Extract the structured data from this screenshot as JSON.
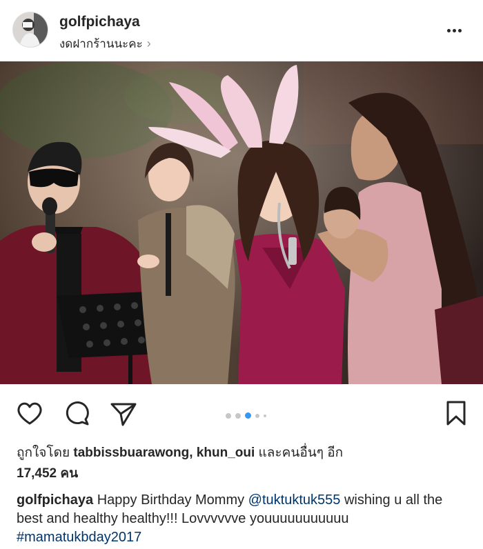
{
  "post": {
    "username": "golfpichaya",
    "location": "งดฝากร้านนะคะ",
    "location_chevron": "›"
  },
  "carousel": {
    "count": 5,
    "active": 3
  },
  "likes": {
    "prefix": "ถูกใจโดย",
    "users": "tabbissbuarawong, khun_oui",
    "middle": "และคนอื่นๆ อีก",
    "count": "17,452 คน"
  },
  "caption": {
    "username": "golfpichaya",
    "text_1": "Happy Birthday Mommy",
    "mention": "@tuktuktuk555",
    "text_2": "wishing u all the best and healthy healthy!!! Lovvvvvve youuuuuuuuuuu",
    "hashtag": "#mamatukbday2017"
  },
  "icons": {
    "like": "heart-icon",
    "comment": "comment-icon",
    "share": "send-icon",
    "save": "bookmark-icon",
    "more": "more-icon"
  },
  "colors": {
    "link": "#003569",
    "dot_active": "#3897f0",
    "dot_inactive": "#c7c7c7"
  }
}
